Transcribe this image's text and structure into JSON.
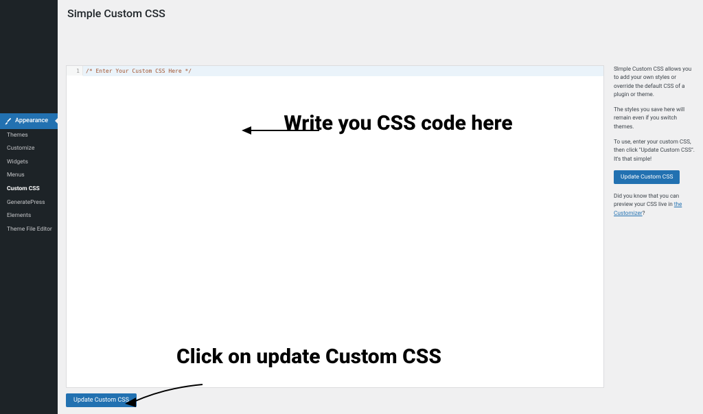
{
  "header": {
    "title": "Simple Custom CSS"
  },
  "sidebar": {
    "appearance": {
      "label": "Appearance"
    },
    "submenu": [
      {
        "label": "Themes",
        "active": false
      },
      {
        "label": "Customize",
        "active": false
      },
      {
        "label": "Widgets",
        "active": false
      },
      {
        "label": "Menus",
        "active": false
      },
      {
        "label": "Custom CSS",
        "active": true
      },
      {
        "label": "GeneratePress",
        "active": false
      },
      {
        "label": "Elements",
        "active": false
      },
      {
        "label": "Theme File Editor",
        "active": false
      }
    ]
  },
  "editor": {
    "line_number": "1",
    "placeholder_comment": "/* Enter Your Custom CSS Here */",
    "scroll_marker": "^"
  },
  "panel": {
    "p1": "Simple Custom CSS allows you to add your own styles or override the default CSS of a plugin or theme.",
    "p2": "The styles you save here will remain even if you switch themes.",
    "p3": "To use, enter your custom CSS, then click \"Update Custom CSS\". It's that simple!",
    "tip_prefix": "Did you know that you can preview your CSS live in ",
    "tip_link": "the Customizer",
    "tip_suffix": "?"
  },
  "buttons": {
    "update": "Update Custom CSS"
  },
  "annotations": {
    "write_here": "Write you CSS code here",
    "click_update": "Click on update Custom CSS"
  }
}
